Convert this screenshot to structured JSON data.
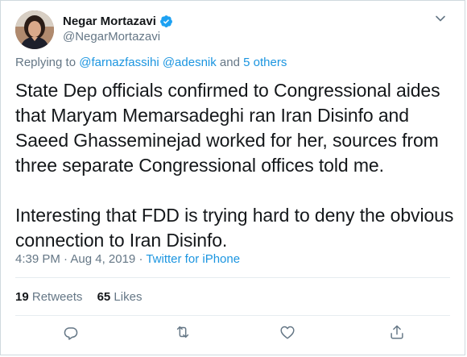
{
  "author": {
    "display_name": "Negar Mortazavi",
    "handle": "@NegarMortazavi",
    "verified": true
  },
  "reply": {
    "prefix": "Replying to ",
    "mention_1": "@farnazfassihi",
    "mention_2": "@adesnik",
    "and_text": " and ",
    "others": "5 others"
  },
  "tweet": {
    "text": "State Dep officials confirmed to Congressional aides that Maryam Memarsadeghi ran Iran Disinfo and Saeed Ghasseminejad worked for her, sources from three separate Congressional offices told me.\n\nInteresting that FDD is trying hard to deny the obvious connection to Iran Disinfo."
  },
  "meta": {
    "timestamp": "4:39 PM · Aug 4, 2019",
    "separator": " · ",
    "source": "Twitter for iPhone"
  },
  "stats": {
    "retweets_count": "19",
    "retweets_label": "Retweets",
    "likes_count": "65",
    "likes_label": "Likes"
  },
  "actions": [
    "reply-icon",
    "retweet-icon",
    "like-icon",
    "share-icon"
  ],
  "colors": {
    "text": "#14171a",
    "muted": "#657786",
    "link": "#1b95e0",
    "verified": "#1da1f2",
    "divider": "#e6ecf0"
  }
}
